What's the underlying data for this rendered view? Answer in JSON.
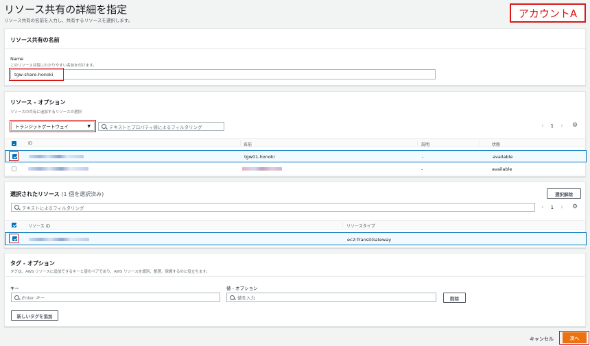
{
  "page": {
    "title": "リソース共有の詳細を指定",
    "description": "リソース共有の名前を入力し、共有するリソースを選択します。",
    "account_tag": "アカウントA"
  },
  "name_panel": {
    "heading": "リソース共有の名前",
    "label": "Name",
    "hint": "このリソース共有にわかりやすい名前を付けます。",
    "value": "tgw-share-honoki"
  },
  "resources_panel": {
    "heading": "リソース - オプション",
    "hint": "リソースの共有に追加するリソースの選択",
    "resource_type": "トランジットゲートウェイ",
    "filter_placeholder": "テキストとプロパティ値によるフィルタリング",
    "page": "1",
    "columns": [
      "ID",
      "名前",
      "説明",
      "状態"
    ],
    "rows": [
      {
        "selected": true,
        "id": "",
        "name": "tgw01-honoki",
        "description": "-",
        "state": "available"
      },
      {
        "selected": false,
        "id": "",
        "name": "",
        "description": "-",
        "state": "available"
      }
    ]
  },
  "selected_panel": {
    "heading": "選択されたリソース",
    "count_text": "(1 個を選択済み)",
    "deselect_label": "選択解除",
    "filter_placeholder": "テキストによるフィルタリング",
    "page": "1",
    "columns": [
      "リソース ID",
      "リソースタイプ"
    ],
    "rows": [
      {
        "selected": true,
        "id": "",
        "type": "ec2:TransitGateway"
      }
    ]
  },
  "tags_panel": {
    "heading": "タグ - オプション",
    "hint": "タグは、AWS リソースに追加できるキーと値のペアであり、AWS リソースを識別、整理、保護するのに役立ちます。",
    "key_label": "キー",
    "value_label": "値 - オプション",
    "key_placeholder": "Enter キー",
    "value_placeholder": "値を入力",
    "remove_label": "削除",
    "add_label": "新しいタグを追加"
  },
  "footer": {
    "cancel_label": "キャンセル",
    "next_label": "次へ"
  },
  "colors": {
    "accent": "#0073bb",
    "primary_button": "#ec7211",
    "highlight": "#d91515"
  }
}
